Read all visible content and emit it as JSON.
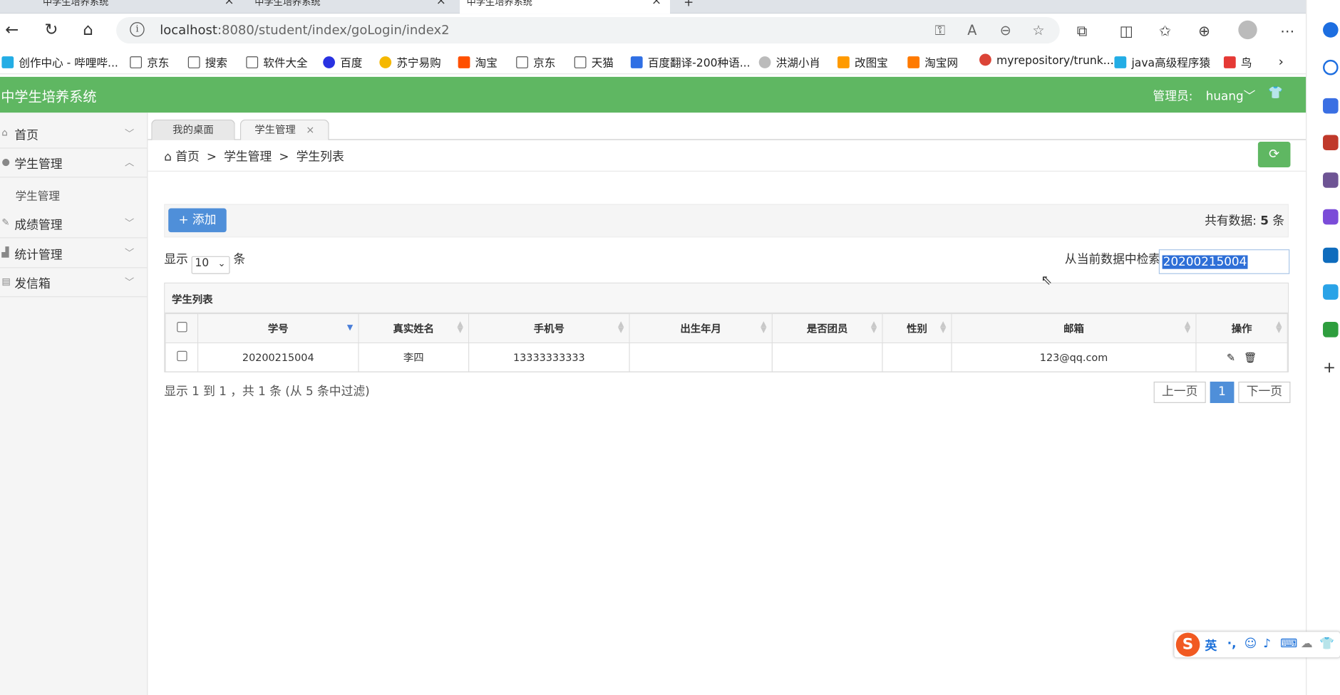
{
  "browser": {
    "tabs": [
      "中学生培养系统",
      "中学生培养系统",
      "中学生培养系统"
    ],
    "new_tab": "+",
    "url_host": "localhost",
    "url_rest": ":8080/student/index/goLogin/index2",
    "bookmarks": [
      "创作中心 - 哔哩哔...",
      "京东",
      "搜索",
      "软件大全",
      "百度",
      "苏宁易购",
      "淘宝",
      "京东",
      "天猫",
      "百度翻译-200种语...",
      "洪湖小肖",
      "改图宝",
      "淘宝网",
      "myrepository/trunk...",
      "java高级程序猿",
      "鸟"
    ]
  },
  "app": {
    "title": "中学生培养系统",
    "admin_label": "管理员:",
    "admin_name": "huang",
    "accent": "#5fb762"
  },
  "sidebar": {
    "items": [
      {
        "label": "首页",
        "icon": "home-icon",
        "chevron": "﹀"
      },
      {
        "label": "学生管理",
        "icon": "user-icon",
        "chevron": "︿"
      },
      {
        "label": "成绩管理",
        "icon": "edit-icon",
        "chevron": "﹀"
      },
      {
        "label": "统计管理",
        "icon": "chart-icon",
        "chevron": "﹀"
      },
      {
        "label": "发信箱",
        "icon": "mail-icon",
        "chevron": "﹀"
      }
    ],
    "submenu": "学生管理"
  },
  "page_tabs": [
    {
      "label": "我的桌面"
    },
    {
      "label": "学生管理",
      "close": "×"
    }
  ],
  "breadcrumb": {
    "home": "首页",
    "sep1": ">",
    "level1": "学生管理",
    "sep2": ">",
    "level2": "学生列表"
  },
  "toolbar": {
    "add_label": "+ 添加",
    "total_prefix": "共有数据:",
    "total_count": "5",
    "total_suffix": "条"
  },
  "length": {
    "prefix": "显示",
    "value": "10",
    "suffix": "条"
  },
  "search": {
    "label": "从当前数据中检索:",
    "value": "20200215004"
  },
  "table": {
    "title": "学生列表",
    "headers": [
      "学号",
      "真实姓名",
      "手机号",
      "出生年月",
      "是否团员",
      "性别",
      "邮箱",
      "操作"
    ],
    "rows": [
      {
        "id": "20200215004",
        "name": "李四",
        "phone": "13333333333",
        "birth": "",
        "member": "",
        "gender": "",
        "email": "123@qq.com"
      }
    ]
  },
  "info": "显示 1 到 1 ，共 1 条 (从 5 条中过滤)",
  "pagination": {
    "prev": "上一页",
    "current": "1",
    "next": "下一页"
  },
  "ime": {
    "lang": "英"
  }
}
